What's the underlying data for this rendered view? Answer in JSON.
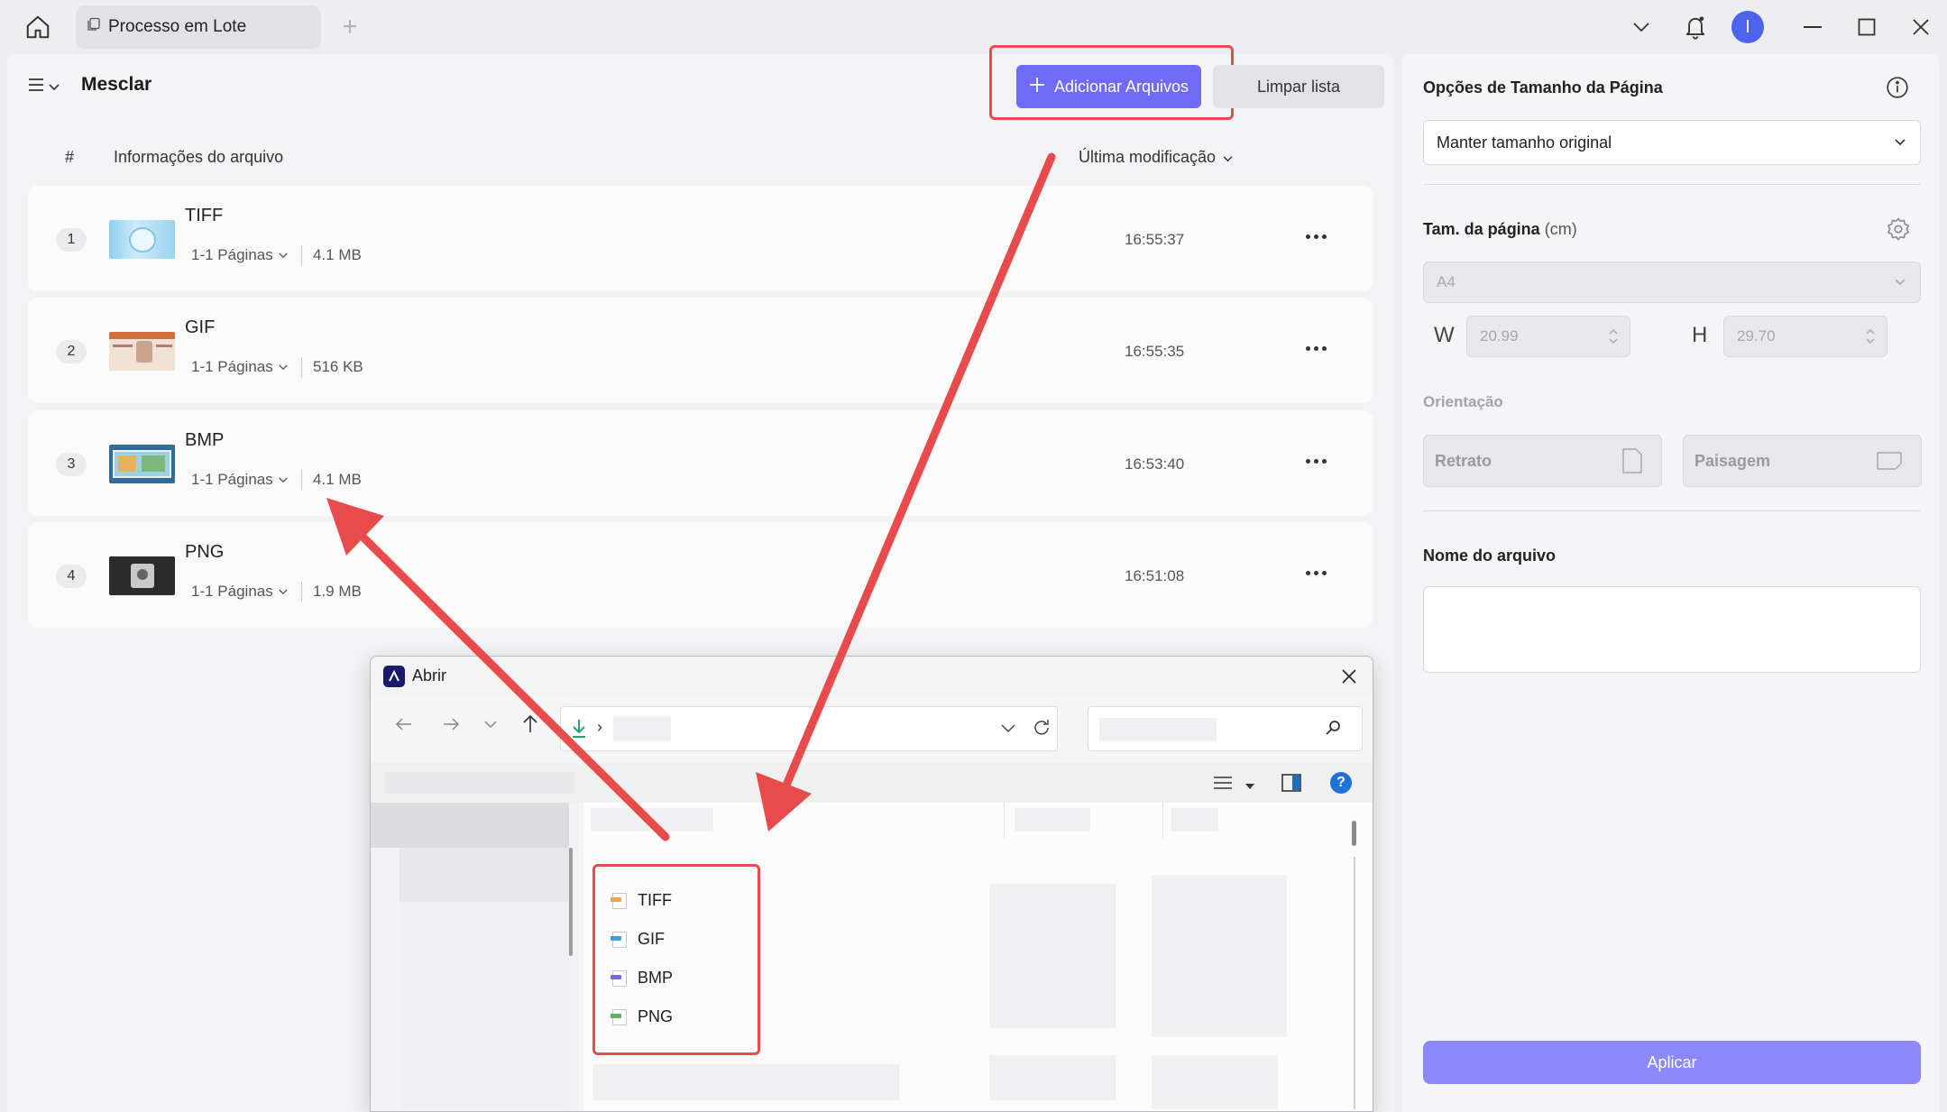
{
  "titlebar": {
    "tab_label": "Processo em Lote",
    "avatar_initial": "I"
  },
  "toolbar": {
    "title": "Mesclar",
    "add_files_label": "Adicionar Arquivos",
    "clear_list_label": "Limpar lista"
  },
  "table": {
    "col_num": "#",
    "col_info": "Informações do arquivo",
    "col_modified": "Última modificação"
  },
  "files": [
    {
      "num": "1",
      "name": "TIFF",
      "pages": "1-1 Páginas",
      "size": "4.1 MB",
      "time": "16:55:37"
    },
    {
      "num": "2",
      "name": "GIF",
      "pages": "1-1 Páginas",
      "size": "516 KB",
      "time": "16:55:35"
    },
    {
      "num": "3",
      "name": "BMP",
      "pages": "1-1 Páginas",
      "size": "4.1 MB",
      "time": "16:53:40"
    },
    {
      "num": "4",
      "name": "PNG",
      "pages": "1-1 Páginas",
      "size": "1.9 MB",
      "time": "16:51:08"
    }
  ],
  "side": {
    "page_size_options_title": "Opções de Tamanho da Página",
    "page_size_select": "Manter tamanho original",
    "page_size_label": "Tam. da página",
    "page_size_unit": "(cm)",
    "paper_select": "A4",
    "w_label": "W",
    "w_value": "20.99",
    "h_label": "H",
    "h_value": "29.70",
    "orientation_label": "Orientação",
    "portrait_label": "Retrato",
    "landscape_label": "Paisagem",
    "filename_label": "Nome do arquivo",
    "filename_value": "",
    "apply_label": "Aplicar"
  },
  "dialog": {
    "title": "Abrir",
    "file_types": [
      "TIFF",
      "GIF",
      "BMP",
      "PNG"
    ]
  },
  "colors": {
    "accent": "#6f6af8",
    "apply": "#8d88fa",
    "annotation_red": "#e84b4b",
    "avatar": "#4d63f0"
  }
}
